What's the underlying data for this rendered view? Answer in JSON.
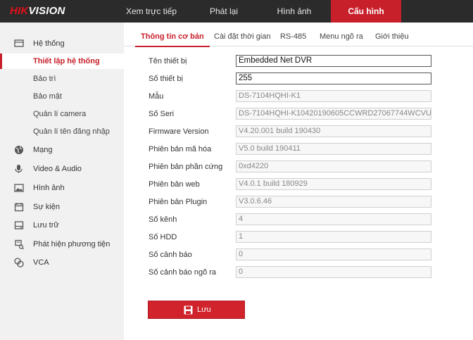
{
  "brand": {
    "part1": "HIK",
    "part2": "VISION"
  },
  "nav": {
    "items": [
      {
        "label": "Xem trực tiếp"
      },
      {
        "label": "Phát lại"
      },
      {
        "label": "Hình ảnh"
      },
      {
        "label": "Cấu hình"
      }
    ],
    "active_index": 3
  },
  "sidebar": {
    "system": {
      "label": "Hệ thống",
      "subitems": [
        {
          "label": "Thiết lập hệ thống",
          "active": true
        },
        {
          "label": "Bảo trì"
        },
        {
          "label": "Bảo mật"
        },
        {
          "label": "Quản lí camera"
        },
        {
          "label": "Quản lí tên đăng nhập"
        }
      ]
    },
    "groups": [
      {
        "label": "Mạng",
        "icon": "globe-icon"
      },
      {
        "label": "Video & Audio",
        "icon": "mic-icon"
      },
      {
        "label": "Hình ảnh",
        "icon": "image-icon"
      },
      {
        "label": "Sự kiện",
        "icon": "calendar-icon"
      },
      {
        "label": "Lưu trữ",
        "icon": "storage-icon"
      },
      {
        "label": "Phát hiện phương tiện",
        "icon": "vehicle-icon"
      },
      {
        "label": "VCA",
        "icon": "vca-icon"
      }
    ]
  },
  "tabs": [
    {
      "label": "Thông tin cơ bản",
      "active": true
    },
    {
      "label": "Cài đặt thời gian"
    },
    {
      "label": "RS-485"
    },
    {
      "label": "Menu ngõ ra"
    },
    {
      "label": "Giới thiệu"
    }
  ],
  "form": {
    "rows": [
      {
        "label": "Tên thiết bị",
        "value": "Embedded Net DVR",
        "editable": true
      },
      {
        "label": "Số thiết bị",
        "value": "255",
        "editable": true
      },
      {
        "label": "Mẫu",
        "value": "DS-7104HQHI-K1"
      },
      {
        "label": "Số Seri",
        "value": "DS-7104HQHI-K10420190605CCWRD27067744WCVU"
      },
      {
        "label": "Firmware Version",
        "value": "V4.20.001 build 190430"
      },
      {
        "label": "Phiên bản mã hóa",
        "value": "V5.0 build 190411"
      },
      {
        "label": "Phiên bản phần cứng",
        "value": "0xd4220"
      },
      {
        "label": "Phiên bản web",
        "value": "V4.0.1 build 180929"
      },
      {
        "label": "Phiên bản Plugin",
        "value": "V3.0.6.46"
      },
      {
        "label": "Số kênh",
        "value": "4"
      },
      {
        "label": "Số HDD",
        "value": "1"
      },
      {
        "label": "Số cảnh báo",
        "value": "0"
      },
      {
        "label": "Số cảnh báo ngõ ra",
        "value": "0"
      }
    ]
  },
  "save_button": {
    "label": "Lưu",
    "icon": "save-icon"
  },
  "colors": {
    "accent": "#c8202a",
    "topbar": "#2b2b2b",
    "sidebar_bg": "#f1f1f1"
  }
}
